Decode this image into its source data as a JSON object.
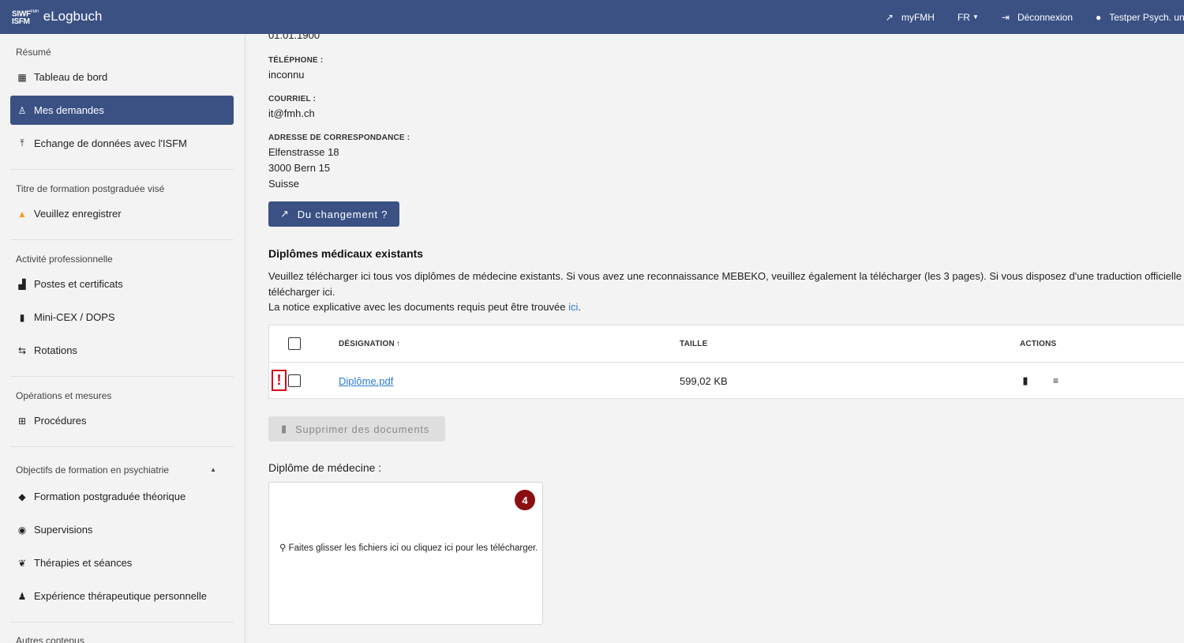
{
  "header": {
    "logo_top": "SIWF",
    "logo_small": "FMH",
    "logo_bottom": "ISFM",
    "app_name": "eLogbuch",
    "links": {
      "myfmh": "myFMH",
      "language": "FR",
      "logout": "Déconnexion",
      "user": "Testper Psych. uno"
    }
  },
  "sidebar": {
    "sections": {
      "resume": "Résumé",
      "titre": "Titre de formation postgraduée visé",
      "activite": "Activité professionnelle",
      "operations": "Opérations et mesures",
      "objectifs": "Objectifs de formation en psychiatrie",
      "autres": "Autres contenus"
    },
    "items": {
      "tableau": "Tableau de bord",
      "demandes": "Mes demandes",
      "echange": "Echange de données avec l'ISFM",
      "veuillez": "Veuillez enregistrer",
      "postes": "Postes et certificats",
      "minicex": "Mini-CEX / DOPS",
      "rotations": "Rotations",
      "procedures": "Procédures",
      "formation": "Formation postgraduée théorique",
      "supervisions": "Supervisions",
      "therapies": "Thérapies et séances",
      "experience": "Expérience thérapeutique personnelle"
    }
  },
  "main": {
    "date_value": "01.01.1900",
    "telephone_label": "TÉLÉPHONE :",
    "telephone_value": "inconnu",
    "courriel_label": "COURRIEL :",
    "courriel_value": "it@fmh.ch",
    "adresse_label": "ADRESSE DE CORRESPONDANCE :",
    "adresse_line1": "Elfenstrasse 18",
    "adresse_line2": "3000 Bern 15",
    "adresse_line3": "Suisse",
    "change_button": "Du changement ?",
    "section_title": "Diplômes médicaux existants",
    "para_line1": "Veuillez télécharger ici tous vos diplômes de médecine existants. Si vous avez une reconnaissance MEBEKO, veuillez également la télécharger (les 3 pages). Si vous disposez d'une traduction officielle des",
    "para_line2": "télécharger ici.",
    "para_line3_pre": "La notice explicative avec les documents requis peut être trouvée ",
    "para_link": "ici",
    "para_line3_post": ".",
    "table": {
      "col_designation": "DÉSIGNATION",
      "col_taille": "TAILLE",
      "col_actions": "ACTIONS",
      "rows": [
        {
          "name": "Diplôme.pdf",
          "size": "599,02 KB"
        }
      ],
      "warning_mark": "!"
    },
    "delete_button": "Supprimer des documents",
    "dropzone_title": "Diplôme de médecine :",
    "dropzone_badge": "4",
    "dropzone_text": "Faites glisser les fichiers ici ou cliquez ici pour les télécharger."
  }
}
